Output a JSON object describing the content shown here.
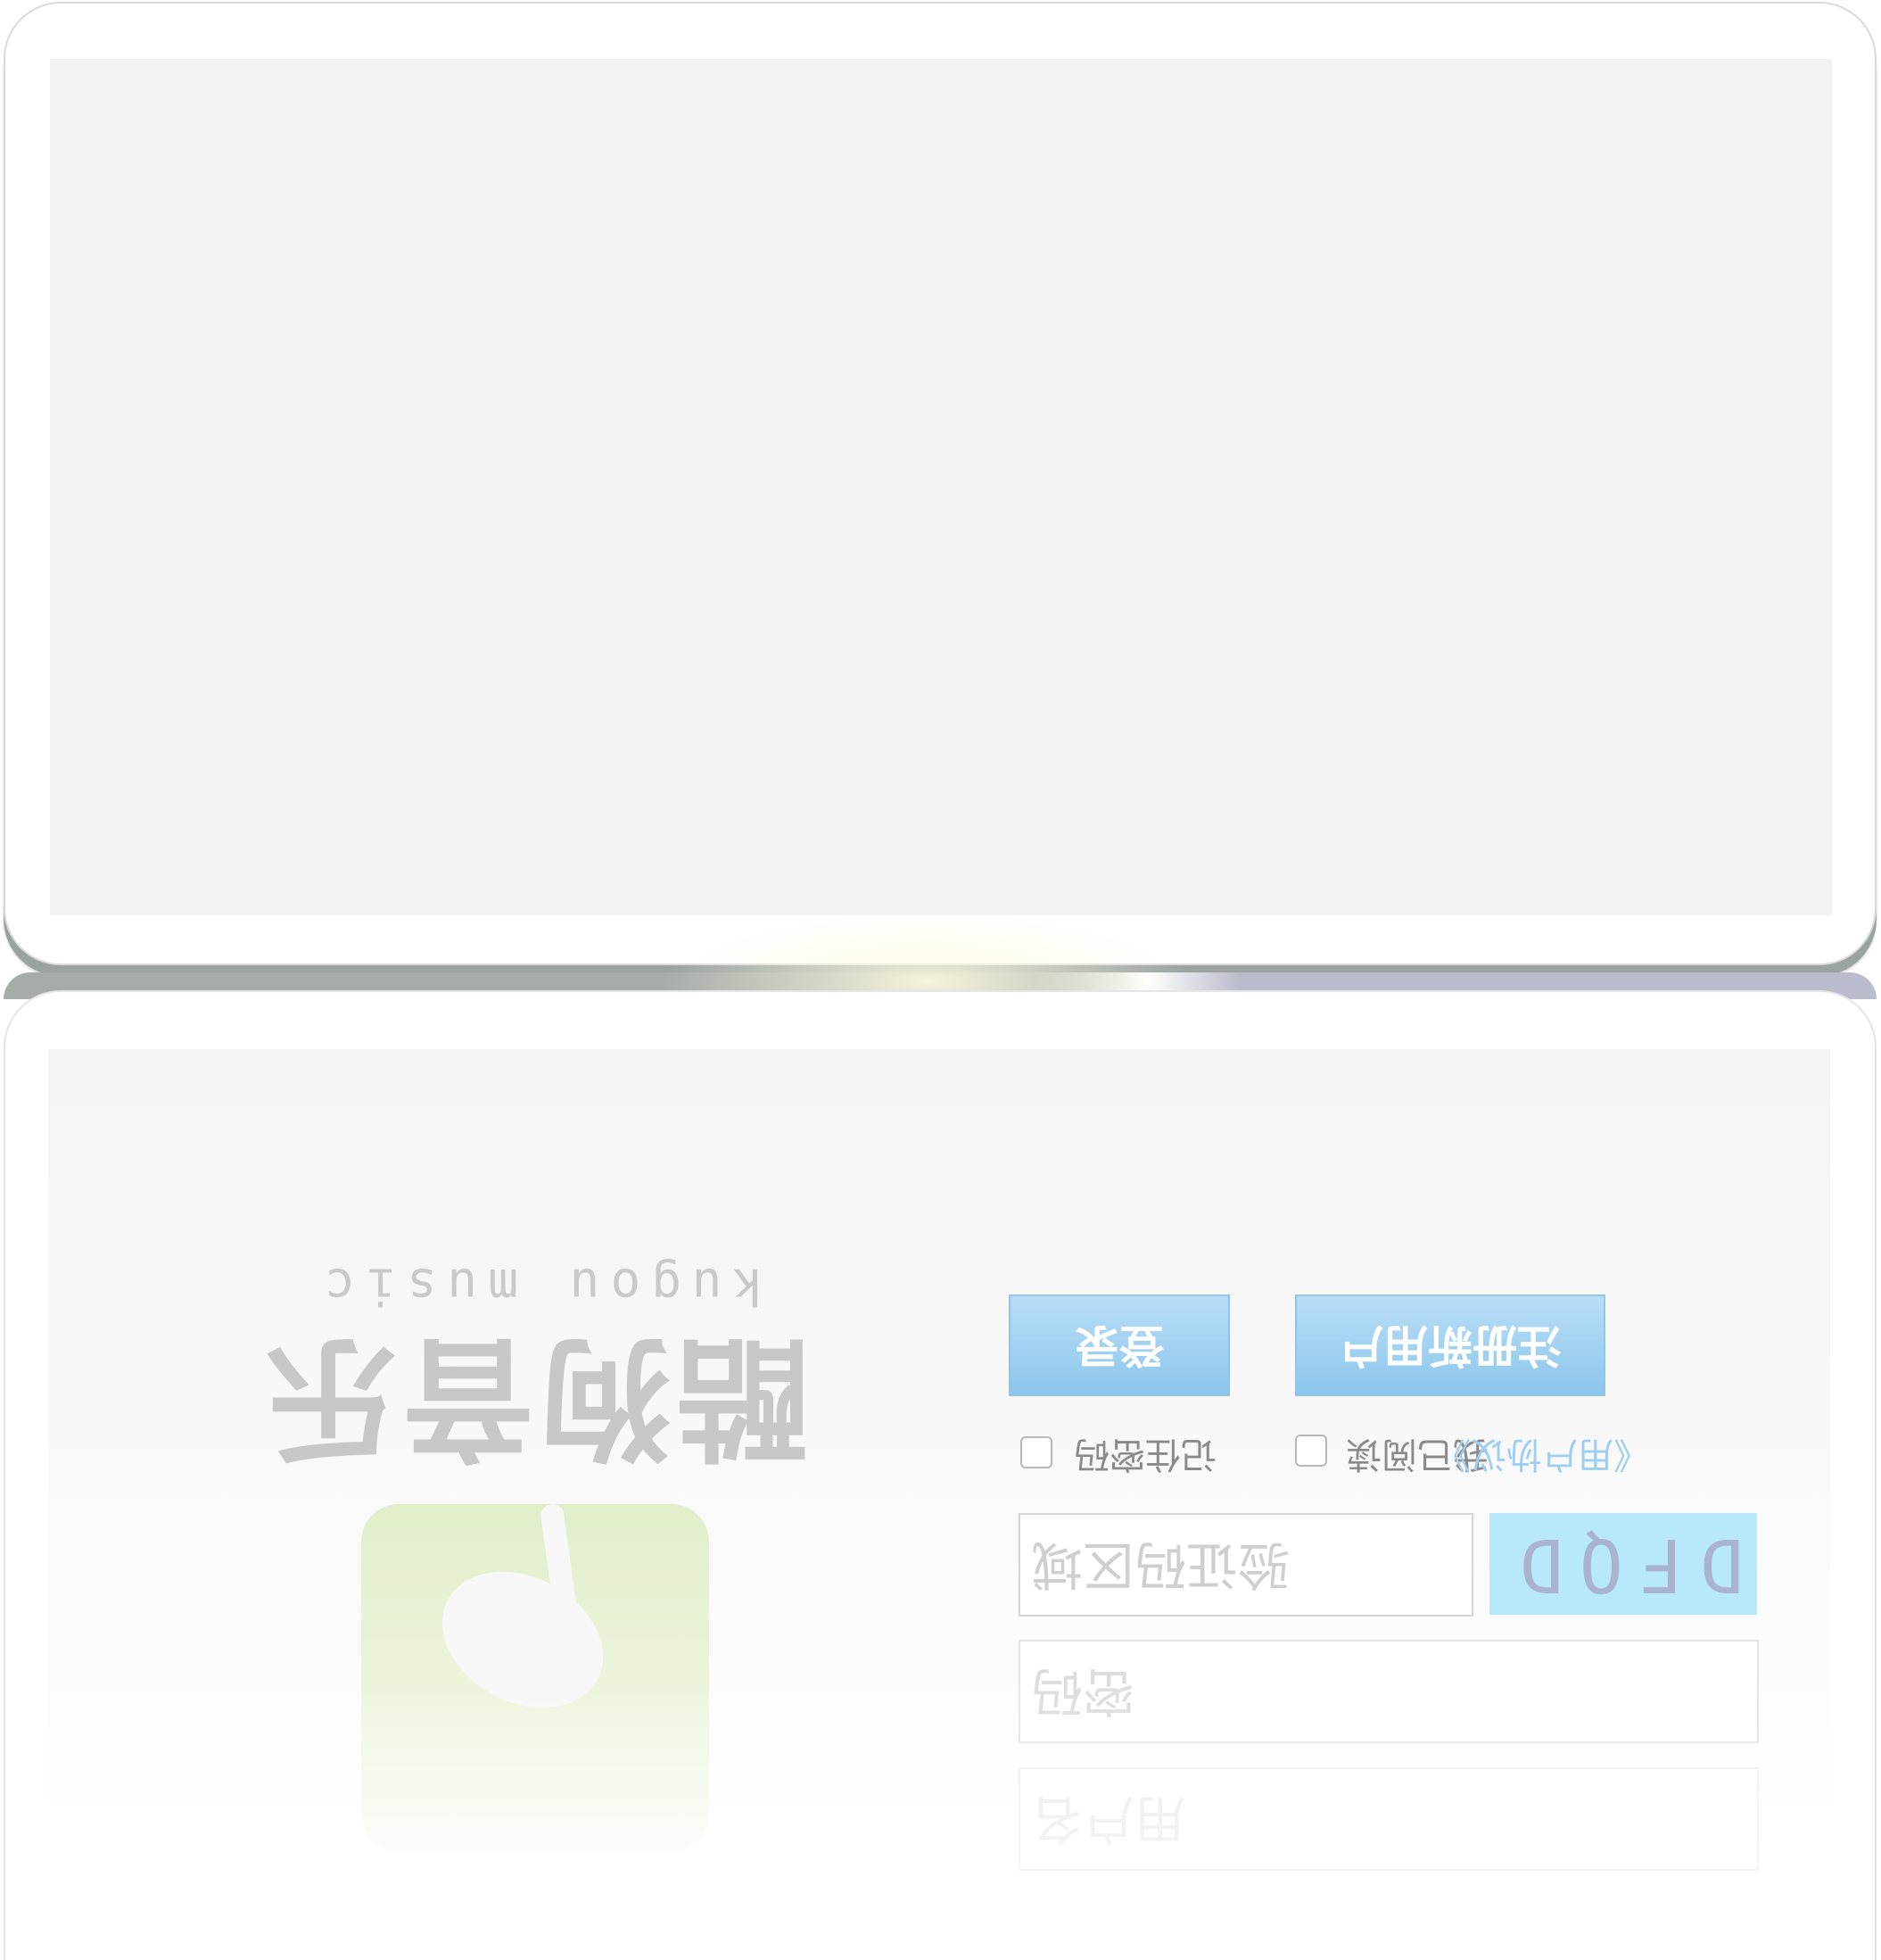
{
  "logo": {
    "title": "酷狗音乐",
    "subtitle": "kugou music"
  },
  "buttons": {
    "login": "登录",
    "register": "注册新用户"
  },
  "options": {
    "remember": "记住密码",
    "agree": "我已阅读",
    "terms": "《用户协议》"
  },
  "fields": {
    "username_placeholder": "用户名",
    "password_placeholder": "密码",
    "captcha_placeholder": "验证码区域"
  },
  "captcha": {
    "code": "DFQD"
  },
  "colors": {
    "button_top": "#8cc6ec",
    "button_bottom": "#b9def7",
    "captcha_bg": "#b7e9fa",
    "link": "#9ecff1",
    "logo_text": "#c7c7c7",
    "icon_green": "#e1eec9"
  }
}
